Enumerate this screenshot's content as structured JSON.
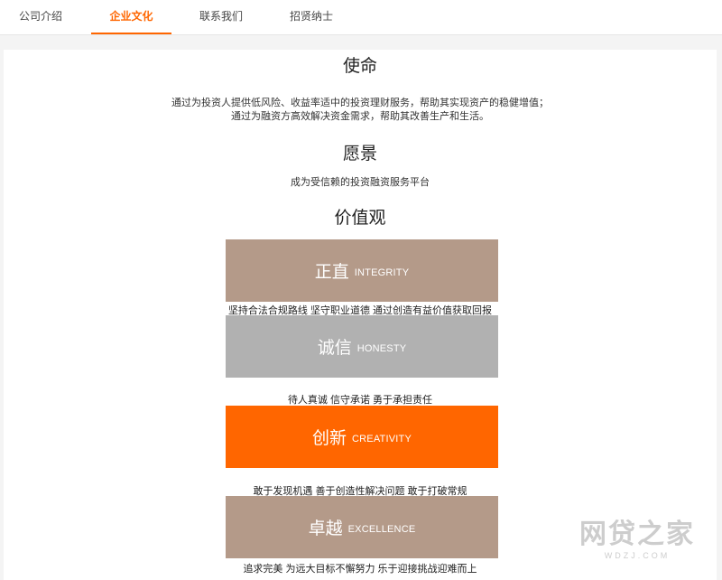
{
  "tabs": [
    {
      "label": "公司介绍",
      "active": false
    },
    {
      "label": "企业文化",
      "active": true
    },
    {
      "label": "联系我们",
      "active": false
    },
    {
      "label": "招贤纳士",
      "active": false
    }
  ],
  "mission": {
    "title": "使命",
    "line1": "通过为投资人提供低风险、收益率适中的投资理财服务，帮助其实现资产的稳健增值；",
    "line2": "通过为融资方高效解决资金需求，帮助其改善生产和生活。"
  },
  "vision": {
    "title": "愿景",
    "text": "成为受信赖的投资融资服务平台"
  },
  "values": {
    "title": "价值观",
    "items": [
      {
        "cn": "正直",
        "en": "INTEGRITY",
        "desc": "坚持合法合规路线 坚守职业道德 通过创造有益价值获取回报",
        "color": "#b49a89"
      },
      {
        "cn": "诚信",
        "en": "HONESTY",
        "desc": "待人真诚 信守承诺 勇于承担责任",
        "color": "#b1b1b1"
      },
      {
        "cn": "创新",
        "en": "CREATIVITY",
        "desc": "敢于发现机遇 善于创造性解决问题 敢于打破常规",
        "color": "#ff6600"
      },
      {
        "cn": "卓越",
        "en": "EXCELLENCE",
        "desc": "追求完美 为远大目标不懈努力 乐于迎接挑战迎难而上",
        "color": "#b49a89"
      }
    ]
  },
  "watermark": {
    "text": "网贷之家",
    "sub": "WDZJ.COM"
  },
  "colors": {
    "accent": "#ff6600"
  }
}
